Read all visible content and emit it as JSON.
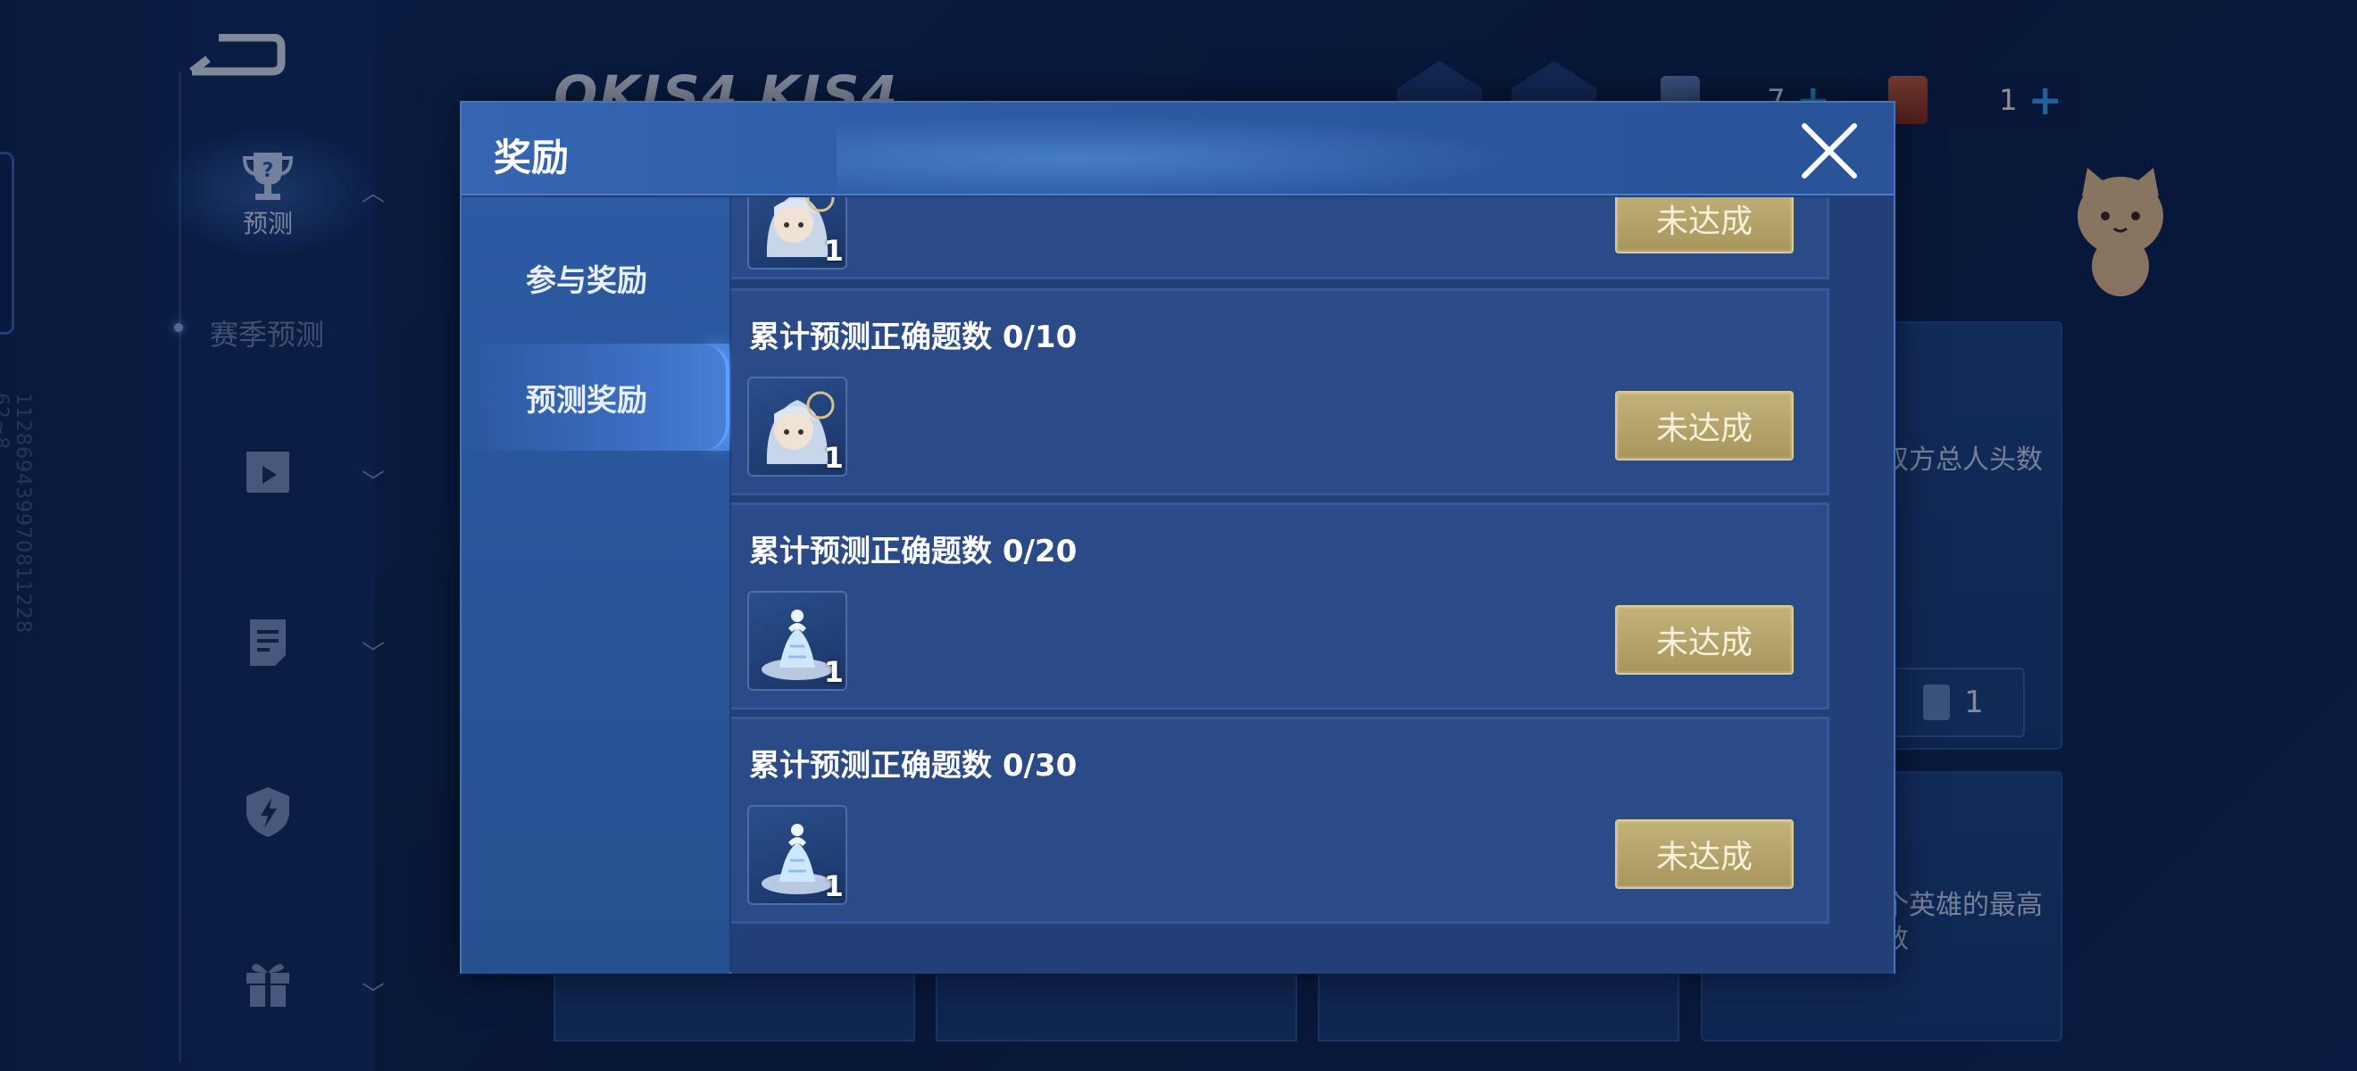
{
  "background": {
    "sidebar": {
      "items": [
        {
          "label": "预测",
          "icon": "trophy-icon"
        },
        {
          "label": "",
          "icon": "video-icon"
        },
        {
          "label": "",
          "icon": "document-icon"
        },
        {
          "label": "",
          "icon": "shield-icon"
        },
        {
          "label": "",
          "icon": "gift-icon"
        }
      ],
      "sub_item": "赛季预测",
      "vertical_id": "112869439970811228​62~8"
    },
    "logo_text": "OKIS4 KIS4",
    "currency": [
      {
        "icon": "ticket-icon",
        "value": "7"
      },
      {
        "icon": "card-icon",
        "value": "1"
      }
    ],
    "cards": [
      {
        "text": "双方总人头数",
        "chip_value": "1"
      },
      {
        "text": "个英雄的最高数"
      }
    ]
  },
  "modal": {
    "title": "奖励",
    "tabs": [
      {
        "label": "参与奖励",
        "active": false
      },
      {
        "label": "预测奖励",
        "active": true
      }
    ],
    "rewards": [
      {
        "title": "",
        "item": "hooded-character-icon",
        "qty": "1",
        "button": "未达成"
      },
      {
        "title": "累计预测正确题数  0/10",
        "item": "hooded-character-icon",
        "qty": "1",
        "button": "未达成"
      },
      {
        "title": "累计预测正确题数  0/20",
        "item": "crystal-trophy-icon",
        "qty": "1",
        "button": "未达成"
      },
      {
        "title": "累计预测正确题数  0/30",
        "item": "crystal-trophy-icon",
        "qty": "1",
        "button": "未达成"
      }
    ]
  },
  "colors": {
    "button_gold": "#b4a468",
    "modal_bg": "#1f3f79",
    "header_blue": "#3666b2"
  }
}
